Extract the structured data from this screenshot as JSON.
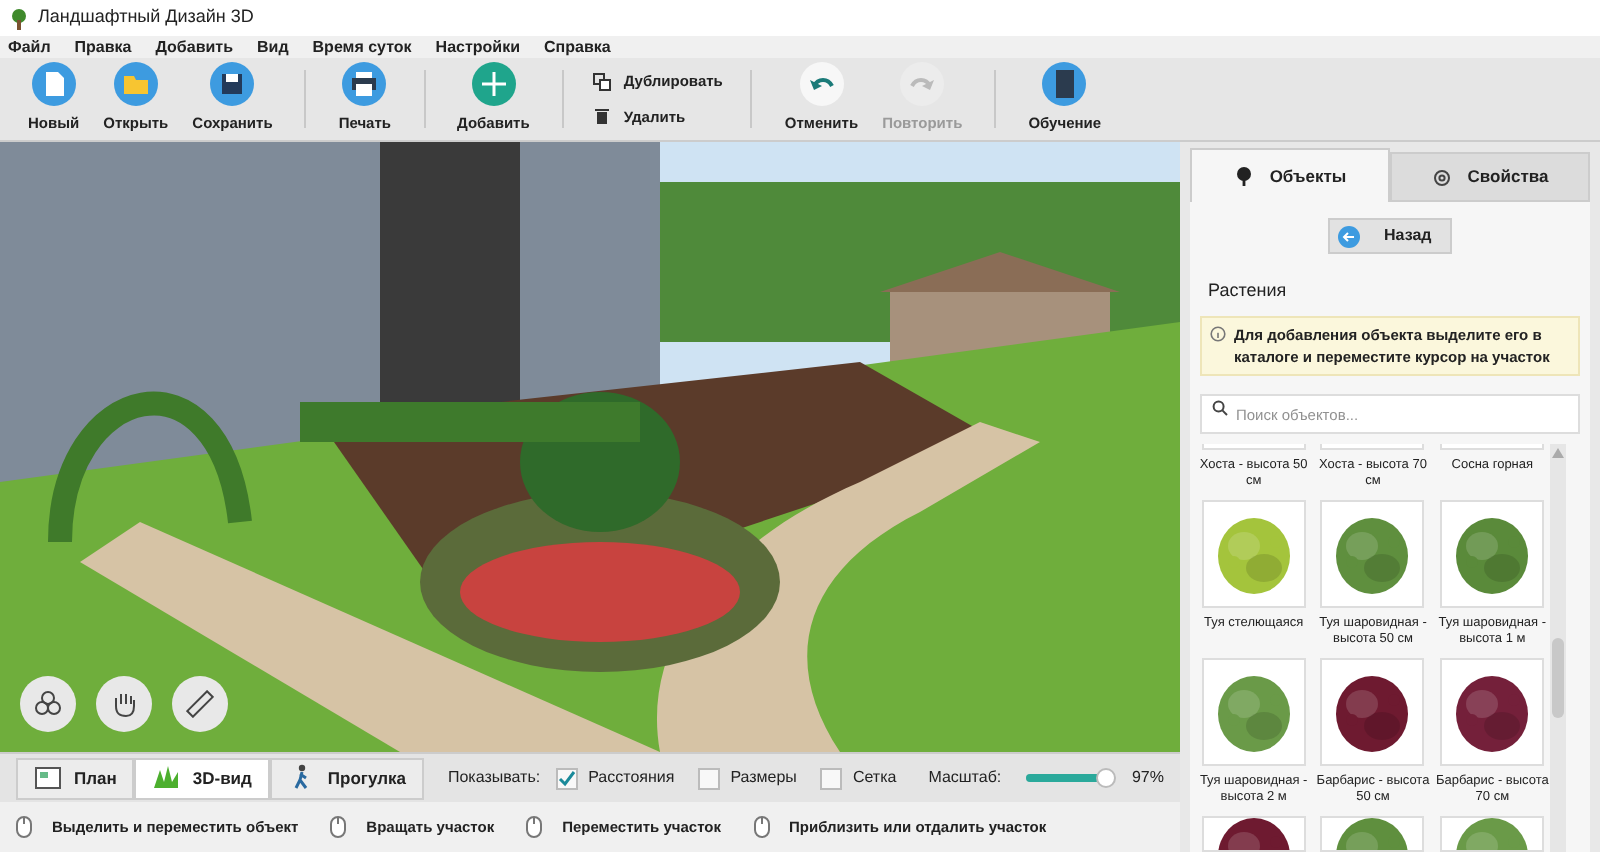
{
  "window": {
    "title": "Ландшафтный Дизайн 3D"
  },
  "menu": [
    "Файл",
    "Правка",
    "Добавить",
    "Вид",
    "Время суток",
    "Настройки",
    "Справка"
  ],
  "toolbar": [
    {
      "kind": "big",
      "label": "Новый",
      "disabled": false
    },
    {
      "kind": "big",
      "label": "Открыть",
      "disabled": false
    },
    {
      "kind": "big",
      "label": "Сохранить",
      "disabled": false
    },
    {
      "kind": "sep"
    },
    {
      "kind": "big",
      "label": "Печать",
      "disabled": false
    },
    {
      "kind": "sep"
    },
    {
      "kind": "big",
      "label": "Добавить",
      "disabled": false
    },
    {
      "kind": "sep"
    },
    {
      "kind": "pair",
      "items": [
        "Дублировать",
        "Удалить"
      ]
    },
    {
      "kind": "sep"
    },
    {
      "kind": "big",
      "label": "Отменить",
      "disabled": false
    },
    {
      "kind": "big",
      "label": "Повторить",
      "disabled": true
    },
    {
      "kind": "sep"
    },
    {
      "kind": "big",
      "label": "Обучение",
      "disabled": false
    }
  ],
  "panel": {
    "tabs": [
      {
        "label": "Объекты",
        "selected": true
      },
      {
        "label": "Свойства",
        "selected": false
      }
    ],
    "back_button": "Назад",
    "section": "Растения",
    "hint": "Для добавления объекта выделите его в каталоге и переместите курсор на участок",
    "search": {
      "placeholder": "Поиск объектов..."
    },
    "catalog": [
      {
        "label": "Хоста - высота 50 см",
        "kind": "cut"
      },
      {
        "label": "Хоста - высота 70 см",
        "kind": "cut"
      },
      {
        "label": "Сосна горная",
        "kind": "cut"
      },
      {
        "label": "Туя стелющаяся",
        "kind": "full"
      },
      {
        "label": "Туя шаровидная - высота 50 см",
        "kind": "full"
      },
      {
        "label": "Туя шаровидная - высота 1 м",
        "kind": "full"
      },
      {
        "label": "Туя шаровидная - высота 2 м",
        "kind": "full"
      },
      {
        "label": "Барбарис - высота 50 см",
        "kind": "full"
      },
      {
        "label": "Барбарис - высота 70 см",
        "kind": "full"
      },
      {
        "kind": "bottom"
      },
      {
        "kind": "bottom"
      },
      {
        "kind": "bottom"
      }
    ]
  },
  "views": [
    {
      "label": "План",
      "selected": false
    },
    {
      "label": "3D-вид",
      "selected": true
    },
    {
      "label": "Прогулка",
      "selected": false
    }
  ],
  "show": {
    "label": "Показывать:",
    "options": [
      {
        "label": "Расстояния",
        "checked": true
      },
      {
        "label": "Размеры",
        "checked": false
      },
      {
        "label": "Сетка",
        "checked": false
      }
    ]
  },
  "zoom": {
    "label": "Масштаб:",
    "level": 0.97,
    "reading": "97%"
  },
  "status": [
    "Выделить и переместить объект",
    "Вращать участок",
    "Переместить участок",
    "Приблизить или отдалить участок"
  ]
}
